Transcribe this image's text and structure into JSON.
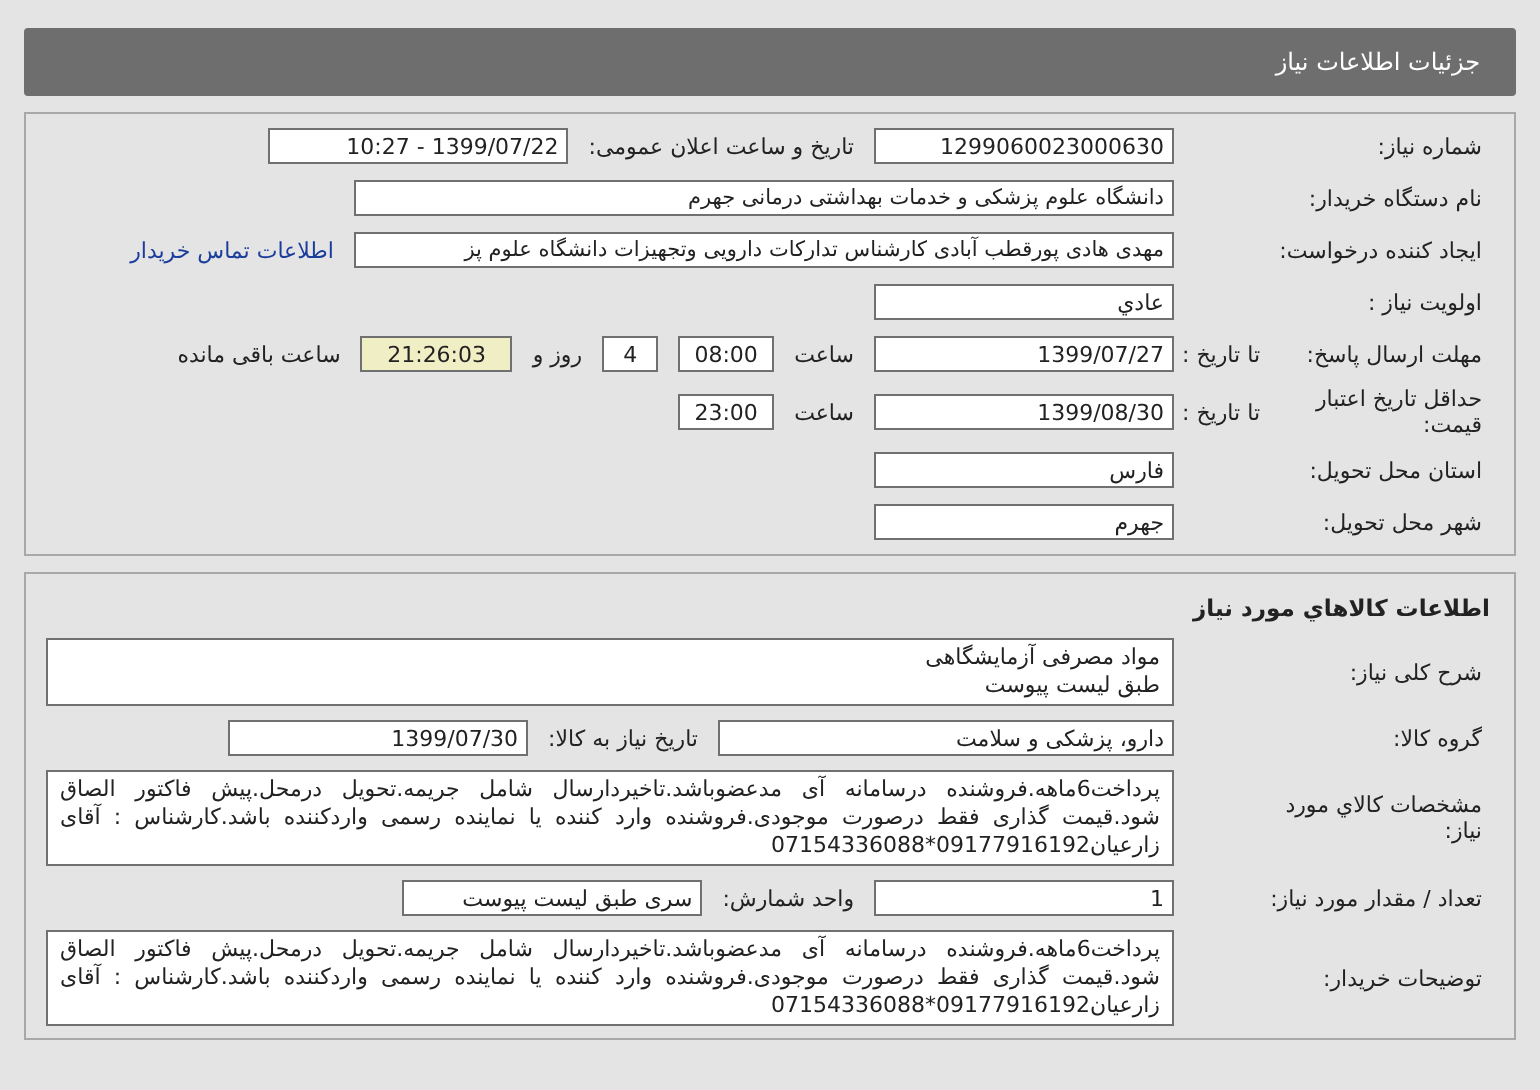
{
  "header": {
    "title": "جزئیات اطلاعات نیاز"
  },
  "need_info": {
    "rows": [
      {
        "label": "شماره نیاز:",
        "items": [
          {
            "kind": "field",
            "value": "1299060023000630"
          },
          {
            "kind": "label",
            "value": "تاریخ و ساعت اعلان عمومی:"
          },
          {
            "kind": "field",
            "value": "1399/07/22 - 10:27"
          }
        ]
      },
      {
        "label": "نام دستگاه خریدار:",
        "items": [
          {
            "kind": "wide_field",
            "value": "دانشگاه علوم پزشکی و خدمات بهداشتی درمانی جهرم"
          }
        ]
      },
      {
        "label": "ایجاد کننده درخواست:",
        "items": [
          {
            "kind": "wide_field",
            "value": "مهدی هادی پورقطب آبادی کارشناس تدارکات دارویی وتجهیزات دانشگاه علوم پز"
          },
          {
            "kind": "link",
            "value": "اطلاعات تماس خریدار"
          }
        ]
      },
      {
        "label": "اولویت نیاز :",
        "items": [
          {
            "kind": "field",
            "value": "عادي"
          }
        ]
      },
      {
        "label": "مهلت ارسال پاسخ:",
        "sublabel": "تا تاریخ :",
        "items": [
          {
            "kind": "field",
            "value": "1399/07/27"
          },
          {
            "kind": "label",
            "value": "ساعت"
          },
          {
            "kind": "small_field",
            "value": "08:00"
          },
          {
            "kind": "tiny_field",
            "value": "4"
          },
          {
            "kind": "label",
            "value": "روز و"
          },
          {
            "kind": "countdown",
            "value": "21:26:03"
          },
          {
            "kind": "label",
            "value": "ساعت باقی مانده"
          }
        ]
      },
      {
        "label": "حداقل تاریخ اعتبار قیمت:",
        "sublabel": "تا تاریخ :",
        "items": [
          {
            "kind": "field",
            "value": "1399/08/30"
          },
          {
            "kind": "label",
            "value": "ساعت"
          },
          {
            "kind": "small_field",
            "value": "23:00"
          }
        ]
      },
      {
        "label": "استان محل تحویل:",
        "items": [
          {
            "kind": "field",
            "value": "فارس"
          }
        ]
      },
      {
        "label": "شهر محل تحویل:",
        "items": [
          {
            "kind": "field",
            "value": "جهرم"
          }
        ]
      }
    ]
  },
  "goods_info": {
    "title": "اطلاعات کالاهاي مورد نیاز",
    "rows": [
      {
        "label": "شرح کلی نیاز:",
        "items": [
          {
            "kind": "area",
            "lines": [
              "مواد مصرفی آزمایشگاهی",
              "طبق لیست پیوست"
            ]
          }
        ]
      },
      {
        "label": "گروه کالا:",
        "items": [
          {
            "kind": "medium_field",
            "value": "دارو، پزشکی و سلامت"
          },
          {
            "kind": "label",
            "value": "تاریخ نیاز به کالا:"
          },
          {
            "kind": "field",
            "value": "1399/07/30"
          }
        ]
      },
      {
        "label": "مشخصات کالاي مورد نیاز:",
        "items": [
          {
            "kind": "area",
            "lines": [
              "پرداخت6ماهه.فروشنده درسامانه آی مدعضوباشد.تاخیردارسال شامل جریمه.تحویل درمحل.پیش فاکتور الصاق شود.قیمت گذاری فقط درصورت موجودی.فروشنده وارد کننده یا نماینده رسمی واردکننده باشد.کارشناس : آقای زارعیان09177916192*07154336088"
            ]
          }
        ]
      },
      {
        "label": "تعداد / مقدار مورد نیاز:",
        "items": [
          {
            "kind": "field",
            "value": "1"
          },
          {
            "kind": "label",
            "value": "واحد شمارش:"
          },
          {
            "kind": "field",
            "value": "سری طبق لیست پیوست"
          }
        ]
      },
      {
        "label": "توضیحات خریدار:",
        "items": [
          {
            "kind": "area",
            "lines": [
              "پرداخت6ماهه.فروشنده درسامانه آی مدعضوباشد.تاخیردارسال شامل جریمه.تحویل درمحل.پیش فاکتور الصاق شود.قیمت گذاری فقط درصورت موجودی.فروشنده وارد کننده یا نماینده رسمی واردکننده باشد.کارشناس : آقای زارعیان09177916192*07154336088"
            ]
          }
        ]
      }
    ]
  }
}
